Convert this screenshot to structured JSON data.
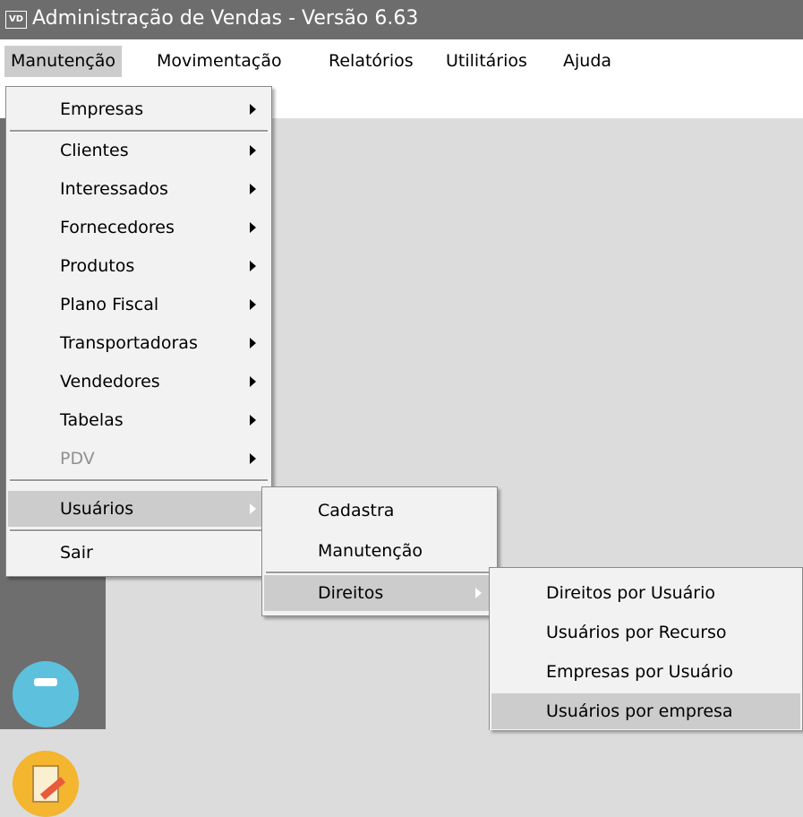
{
  "window": {
    "app_icon_text": "VD",
    "title": "Administração de Vendas - Versão 6.63"
  },
  "menubar": {
    "items": [
      "Manutenção",
      "Movimentação",
      "Relatórios",
      "Utilitários",
      "Ajuda"
    ]
  },
  "menu_manutencao": {
    "items": [
      "Empresas",
      "Clientes",
      "Interessados",
      "Fornecedores",
      "Produtos",
      "Plano Fiscal",
      "Transportadoras",
      "Vendedores",
      "Tabelas",
      "PDV",
      "Usuários",
      "Sair"
    ]
  },
  "menu_usuarios": {
    "items": [
      "Cadastra",
      "Manutenção",
      "Direitos"
    ]
  },
  "menu_direitos": {
    "items": [
      "Direitos por Usuário",
      "Usuários por Recurso",
      "Empresas por Usuário",
      "Usuários por empresa"
    ]
  },
  "colors": {
    "titlebar": "#6d6d6d",
    "highlight": "#cccccc",
    "disabled_text": "#909090"
  },
  "icons": {
    "sidebar_top": "notes-icon",
    "sidebar_bottom": "document-pen-icon",
    "submenu": "triangle-right-icon"
  }
}
